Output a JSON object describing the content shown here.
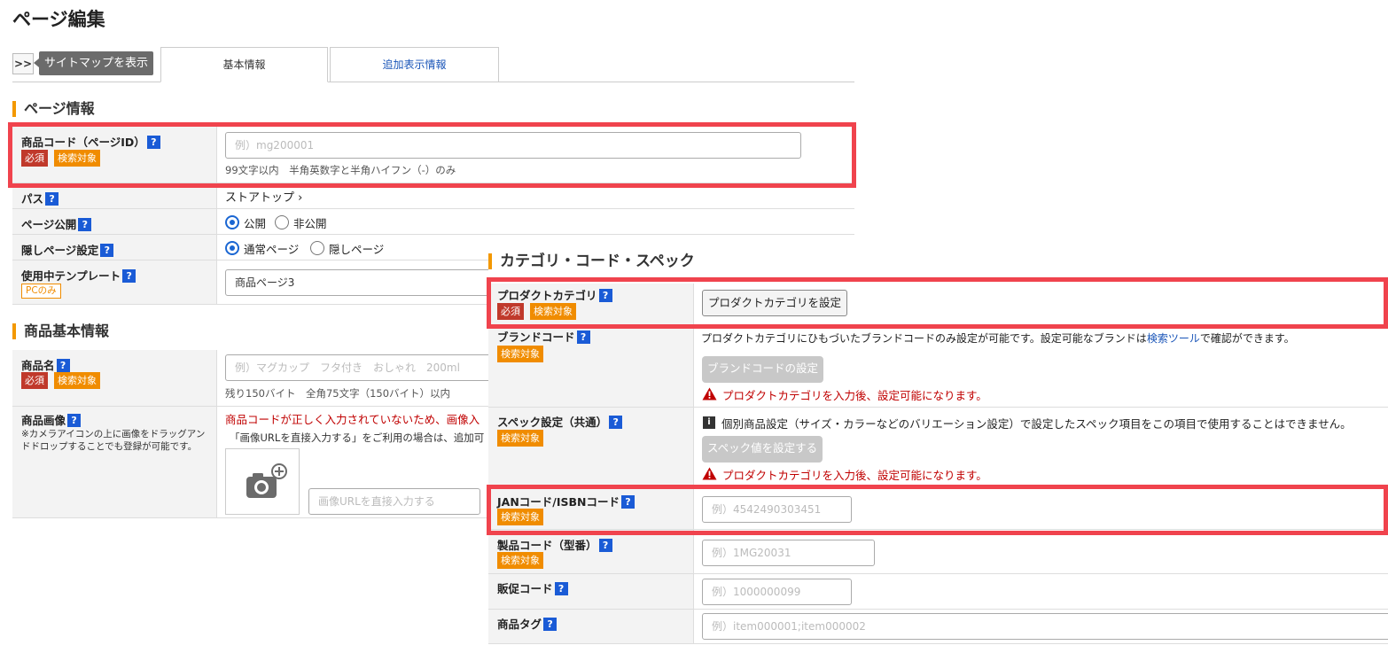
{
  "page_title": "ページ編集",
  "sitemap": {
    "toggle": ">>",
    "tooltip": "サイトマップを表示"
  },
  "tabs": [
    {
      "label": "基本情報"
    },
    {
      "label": "追加表示情報"
    }
  ],
  "page_info": {
    "heading": "ページ情報",
    "product_code": {
      "label": "商品コード（ページID）",
      "badge_required": "必須",
      "badge_search": "検索対象",
      "placeholder": "例）mg200001",
      "note": "99文字以内　半角英数字と半角ハイフン（-）のみ"
    },
    "path": {
      "label": "パス",
      "value": "ストアトップ ›"
    },
    "publish": {
      "label": "ページ公開",
      "options": [
        "公開",
        "非公開"
      ],
      "selected": "公開"
    },
    "hidden": {
      "label": "隠しページ設定",
      "options": [
        "通常ページ",
        "隠しページ"
      ],
      "selected": "通常ページ"
    },
    "template": {
      "label": "使用中テンプレート",
      "badge": "PCのみ",
      "value": "商品ページ3"
    }
  },
  "product_basic": {
    "heading": "商品基本情報",
    "name": {
      "label": "商品名",
      "badge_required": "必須",
      "badge_search": "検索対象",
      "placeholder": "例）マグカップ　フタ付き　おしゃれ　200ml",
      "note": "残り150バイト　全角75文字（150バイト）以内"
    },
    "image": {
      "label": "商品画像",
      "help_text": "※カメラアイコンの上に画像をドラッグアンドドロップすることでも登録が可能です。",
      "error": "商品コードが正しく入力されていないため、画像入",
      "note": "「画像URLを直接入力する」をご利用の場合は、追加可",
      "url_placeholder": "画像URLを直接入力する"
    }
  },
  "category_spec": {
    "heading": "カテゴリ・コード・スペック",
    "product_category": {
      "label": "プロダクトカテゴリ",
      "badge_required": "必須",
      "badge_search": "検索対象",
      "button": "プロダクトカテゴリを設定"
    },
    "brand_code": {
      "label": "ブランドコード",
      "badge_search": "検索対象",
      "desc_before": "プロダクトカテゴリにひもづいたブランドコードのみ設定が可能です。設定可能なブランドは",
      "desc_link": "検索ツール",
      "desc_after": "で確認ができます。",
      "button": "ブランドコードの設定",
      "warning": "プロダクトカテゴリを入力後、設定可能になります。"
    },
    "spec": {
      "label": "スペック設定（共通）",
      "badge_search": "検索対象",
      "info": "個別商品設定（サイズ・カラーなどのバリエーション設定）で設定したスペック項目をこの項目で使用することはできません。",
      "button": "スペック値を設定する",
      "warning": "プロダクトカテゴリを入力後、設定可能になります。"
    },
    "jan": {
      "label": "JANコード/ISBNコード",
      "badge_search": "検索対象",
      "placeholder": "例）4542490303451"
    },
    "model": {
      "label": "製品コード（型番）",
      "badge_search": "検索対象",
      "placeholder": "例）1MG20031"
    },
    "promo": {
      "label": "販促コード",
      "placeholder": "例）1000000099"
    },
    "tag": {
      "label": "商品タグ",
      "placeholder": "例）item000001;item000002"
    }
  },
  "colors": {
    "highlight": "#f0434d",
    "section_accent": "#f39800",
    "required": "#c0392b",
    "search": "#f08c00",
    "help": "#1a5bd6"
  },
  "icons": [
    "help-icon",
    "camera-plus-icon",
    "warning-icon",
    "info-icon",
    "radio-icon"
  ]
}
